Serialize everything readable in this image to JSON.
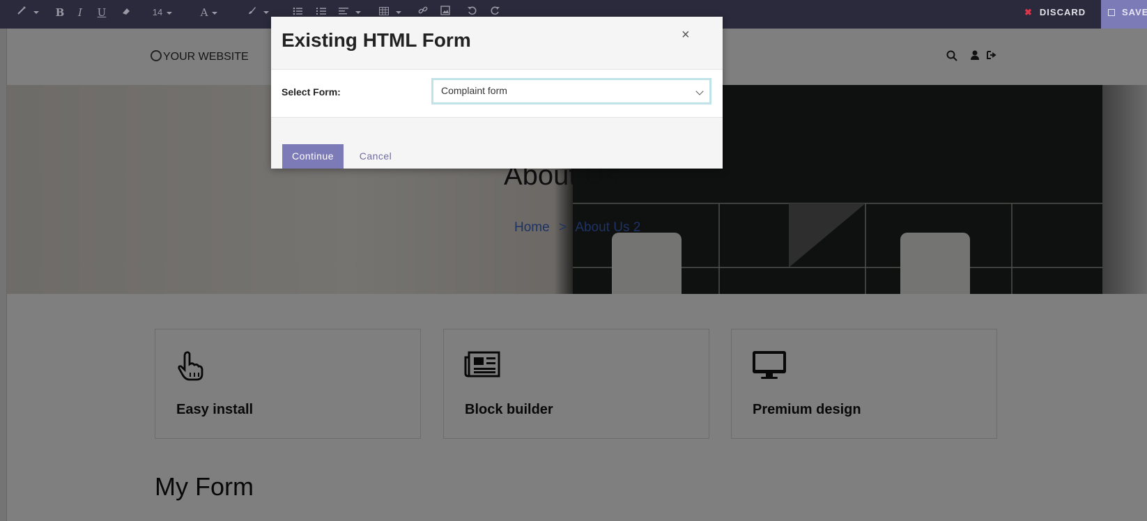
{
  "toolbar": {
    "font_size": "14",
    "discard_label": "DISCARD",
    "save_label": "SAVE",
    "discard_icon": "✖",
    "save_icon": "floppy-icon"
  },
  "header": {
    "logo_text": "YOUR WEBSITE"
  },
  "banner": {
    "title": "About Us",
    "breadcrumb_home": "Home",
    "breadcrumb_sep": ">",
    "breadcrumb_current": "About Us 2"
  },
  "cards": [
    {
      "title": "Easy install",
      "icon": "hand-pointer-icon"
    },
    {
      "title": "Block builder",
      "icon": "newspaper-icon"
    },
    {
      "title": "Premium design",
      "icon": "desktop-icon"
    }
  ],
  "section": {
    "heading": "My Form"
  },
  "modal": {
    "title": "Existing HTML Form",
    "close": "×",
    "select_label": "Select Form:",
    "select_value": "Complaint form",
    "continue_label": "Continue",
    "cancel_label": "Cancel"
  },
  "colors": {
    "toolbar_bg": "#2a2a3c",
    "accent": "#7d7bb7",
    "discard_x": "#e0344a",
    "select_focus": "#bfe3e6"
  }
}
